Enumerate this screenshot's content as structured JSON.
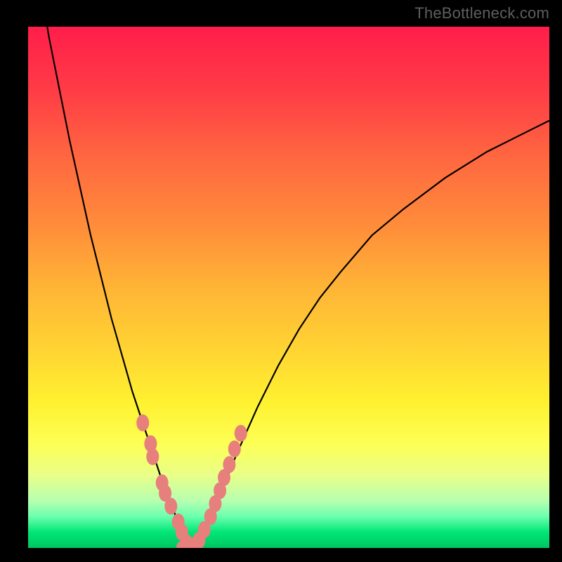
{
  "watermark": "TheBottleneck.com",
  "colors": {
    "frame": "#000000",
    "marker_fill": "#e77f7d",
    "marker_stroke": "#e77f7d",
    "curve_stroke": "#000000",
    "gradient_top": "#ff1e4a",
    "gradient_mid": "#ffd433",
    "gradient_bottom": "#00c560"
  },
  "chart_data": {
    "type": "line",
    "title": "",
    "xlabel": "",
    "ylabel": "",
    "xlim": [
      0,
      100
    ],
    "ylim": [
      0,
      100
    ],
    "grid": false,
    "legend": false,
    "series": [
      {
        "name": "bottleneck-curve",
        "x": [
          2,
          4,
          6,
          8,
          10,
          12,
          14,
          16,
          18,
          20,
          22,
          24,
          26,
          28,
          29,
          30,
          31,
          32,
          34,
          36,
          38,
          40,
          44,
          48,
          52,
          56,
          60,
          66,
          72,
          80,
          88,
          94,
          100
        ],
        "y": [
          110,
          98,
          88,
          78,
          69,
          60,
          52,
          44,
          37,
          30,
          24,
          18,
          12,
          7,
          4,
          1,
          0,
          1,
          4,
          8,
          13,
          18,
          27,
          35,
          42,
          48,
          53,
          60,
          65,
          71,
          76,
          79,
          82
        ]
      }
    ],
    "scatter_left": {
      "name": "left-markers",
      "x": [
        22.0,
        23.5,
        23.9,
        25.7,
        26.3,
        27.4,
        28.8,
        29.5,
        30.4,
        31.0
      ],
      "y": [
        24.0,
        20.0,
        17.5,
        12.5,
        10.5,
        8.0,
        5.0,
        3.0,
        1.0,
        0.5
      ]
    },
    "scatter_right": {
      "name": "right-markers",
      "x": [
        32.0,
        32.8,
        33.8,
        35.0,
        35.9,
        36.8,
        37.6,
        38.6,
        39.6,
        40.8
      ],
      "y": [
        0.5,
        1.5,
        3.5,
        6.0,
        8.5,
        11.0,
        13.5,
        16.0,
        19.0,
        22.0
      ]
    },
    "scatter_bottom": {
      "name": "bottom-markers",
      "x": [
        29.8,
        30.6,
        31.4,
        32.2
      ],
      "y": [
        0.2,
        0.0,
        0.0,
        0.3
      ]
    },
    "annotations": []
  }
}
